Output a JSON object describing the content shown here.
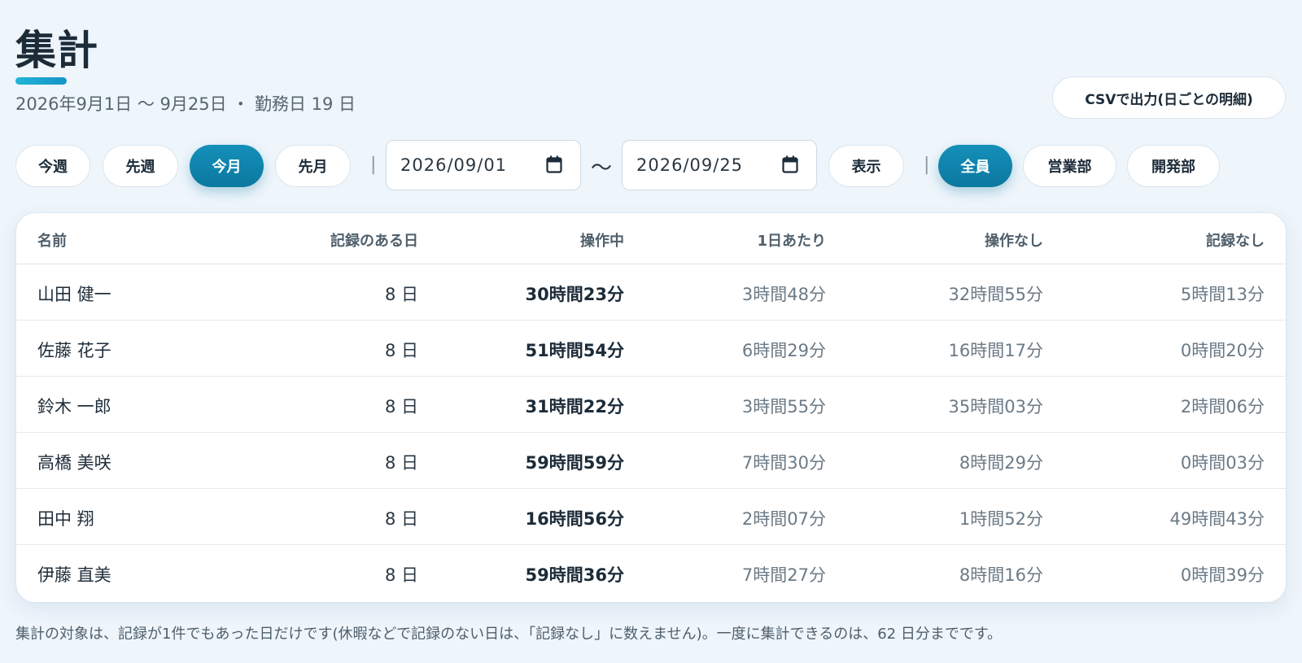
{
  "header": {
    "title": "集計",
    "subtitle": "2026年9月1日 〜 9月25日 ・ 勤務日 19 日",
    "csv_button": "CSVで出力(日ごとの明細)"
  },
  "filters": {
    "periods": [
      {
        "label": "今週",
        "active": false
      },
      {
        "label": "先週",
        "active": false
      },
      {
        "label": "今月",
        "active": true
      },
      {
        "label": "先月",
        "active": false
      }
    ],
    "date_from": "2026/09/01",
    "date_to": "2026/09/25",
    "range_separator": "〜",
    "show_button": "表示",
    "divider": "|",
    "departments": [
      {
        "label": "全員",
        "active": true
      },
      {
        "label": "営業部",
        "active": false
      },
      {
        "label": "開発部",
        "active": false
      }
    ]
  },
  "table": {
    "columns": [
      "名前",
      "記録のある日",
      "操作中",
      "1日あたり",
      "操作なし",
      "記録なし"
    ],
    "rows": [
      {
        "name": "山田 健一",
        "days": "8 日",
        "active": "30時間23分",
        "per_day": "3時間48分",
        "idle": "32時間55分",
        "no_record": "5時間13分"
      },
      {
        "name": "佐藤 花子",
        "days": "8 日",
        "active": "51時間54分",
        "per_day": "6時間29分",
        "idle": "16時間17分",
        "no_record": "0時間20分"
      },
      {
        "name": "鈴木 一郎",
        "days": "8 日",
        "active": "31時間22分",
        "per_day": "3時間55分",
        "idle": "35時間03分",
        "no_record": "2時間06分"
      },
      {
        "name": "高橋 美咲",
        "days": "8 日",
        "active": "59時間59分",
        "per_day": "7時間30分",
        "idle": "8時間29分",
        "no_record": "0時間03分"
      },
      {
        "name": "田中 翔",
        "days": "8 日",
        "active": "16時間56分",
        "per_day": "2時間07分",
        "idle": "1時間52分",
        "no_record": "49時間43分"
      },
      {
        "name": "伊藤 直美",
        "days": "8 日",
        "active": "59時間36分",
        "per_day": "7時間27分",
        "idle": "8時間16分",
        "no_record": "0時間39分"
      }
    ]
  },
  "footnote": "集計の対象は、記録が1件でもあった日だけです(休暇などで記録のない日は、「記録なし」に数えません)。一度に集計できるのは、62 日分までです。",
  "colors": {
    "accent": "#0c789f",
    "background": "#eef5fb"
  }
}
